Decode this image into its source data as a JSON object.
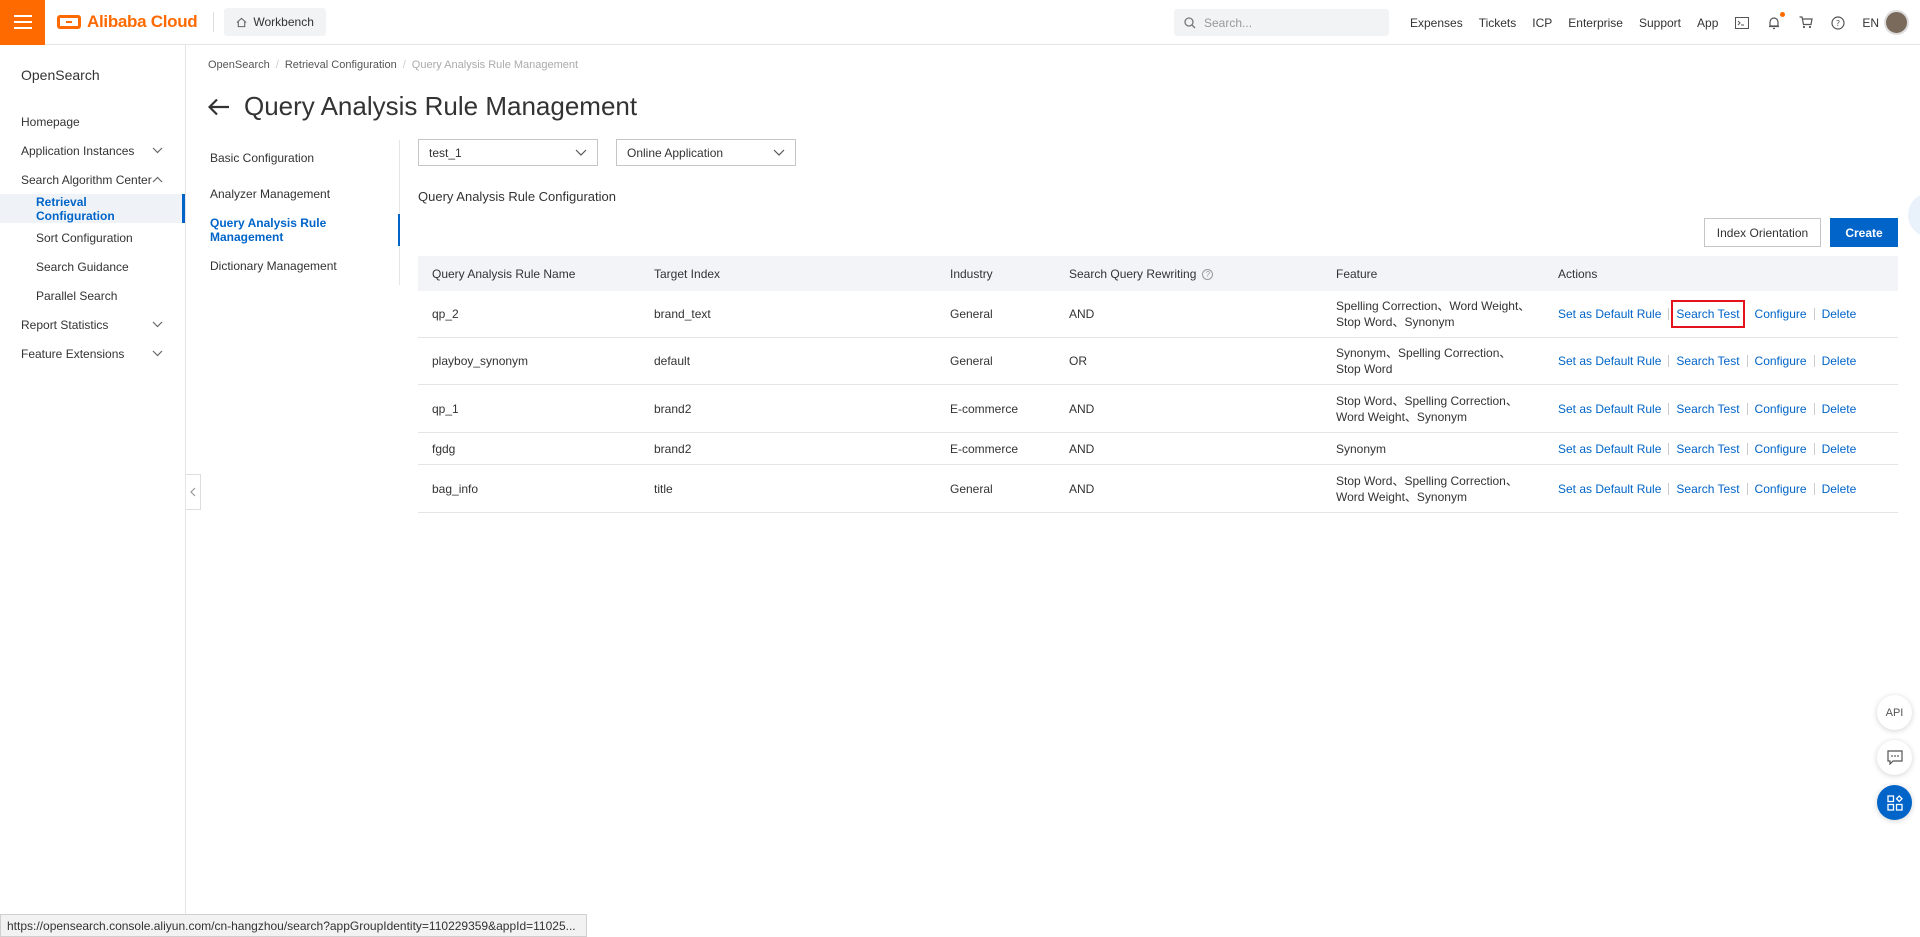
{
  "topbar": {
    "brand": "Alibaba Cloud",
    "workbench": "Workbench",
    "search_placeholder": "Search...",
    "links": [
      "Expenses",
      "Tickets",
      "ICP",
      "Enterprise",
      "Support",
      "App"
    ],
    "lang": "EN"
  },
  "sidebar": {
    "title": "OpenSearch",
    "items": [
      {
        "label": "Homepage"
      },
      {
        "label": "Application Instances"
      },
      {
        "label": "Search Algorithm Center"
      },
      {
        "label": "Retrieval Configuration"
      },
      {
        "label": "Sort Configuration"
      },
      {
        "label": "Search Guidance"
      },
      {
        "label": "Parallel Search"
      },
      {
        "label": "Report Statistics"
      },
      {
        "label": "Feature Extensions"
      }
    ]
  },
  "breadcrumb": [
    "OpenSearch",
    "Retrieval Configuration",
    "Query Analysis Rule Management"
  ],
  "page": {
    "title": "Query Analysis Rule Management",
    "subnav": [
      "Basic Configuration",
      "Analyzer Management",
      "Query Analysis Rule Management",
      "Dictionary Management"
    ],
    "select_instance": "test_1",
    "select_app": "Online Application",
    "section_label": "Query Analysis Rule Configuration",
    "btn_index": "Index Orientation",
    "btn_create": "Create"
  },
  "table": {
    "headers": [
      "Query Analysis Rule Name",
      "Target Index",
      "Industry",
      "Search Query Rewriting",
      "Feature",
      "Actions"
    ],
    "actions": [
      "Set as Default Rule",
      "Search Test",
      "Configure",
      "Delete"
    ],
    "rows": [
      {
        "name": "qp_2",
        "index": "brand_text",
        "industry": "General",
        "rewrite": "AND",
        "feature": "Spelling Correction、Word Weight、Stop Word、Synonym"
      },
      {
        "name": "playboy_synonym",
        "index": "default",
        "industry": "General",
        "rewrite": "OR",
        "feature": "Synonym、Spelling Correction、Stop Word"
      },
      {
        "name": "qp_1",
        "index": "brand2",
        "industry": "E-commerce",
        "rewrite": "AND",
        "feature": "Stop Word、Spelling Correction、Word Weight、Synonym"
      },
      {
        "name": "fgdg",
        "index": "brand2",
        "industry": "E-commerce",
        "rewrite": "AND",
        "feature": "Synonym"
      },
      {
        "name": "bag_info",
        "index": "title",
        "industry": "General",
        "rewrite": "AND",
        "feature": "Stop Word、Spelling Correction、Word Weight、Synonym"
      }
    ]
  },
  "float": {
    "api": "API"
  },
  "status_url": "https://opensearch.console.aliyun.com/cn-hangzhou/search?appGroupIdentity=110229359&appId=11025...",
  "colors": {
    "brand": "#ff6a00",
    "primary": "#0064c8",
    "highlight": "#e4131b"
  }
}
